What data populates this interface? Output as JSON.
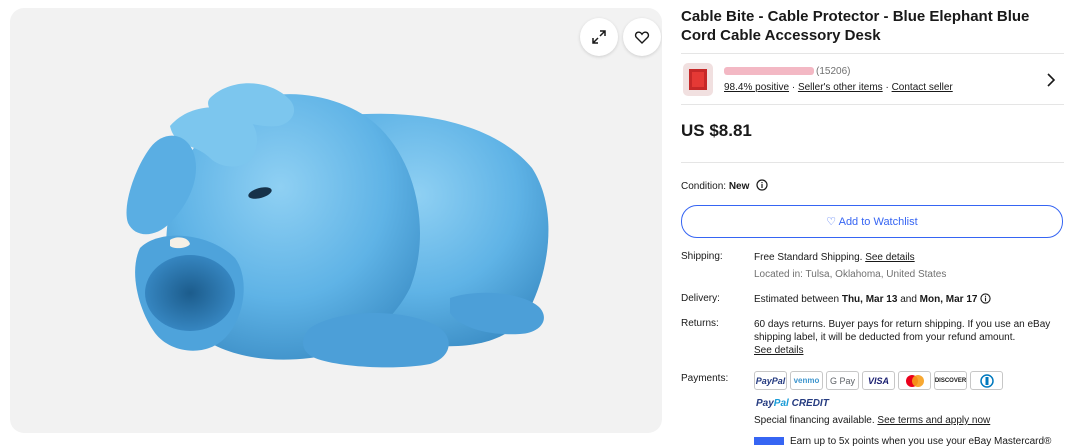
{
  "gallery": {
    "expand_icon": "expand-icon",
    "favorite_icon": "heart-icon"
  },
  "product": {
    "title": "Cable Bite - Cable Protector - Blue Elephant Blue Cord Cable Accessory Desk",
    "price": "US $8.81"
  },
  "seller": {
    "feedback_count": "(15206)",
    "positive": "98.4% positive",
    "other_items": "Seller's other items",
    "contact": "Contact seller",
    "separator": "·"
  },
  "condition": {
    "label": "Condition:",
    "value": "New"
  },
  "watchlist": {
    "label": "♡ Add to Watchlist"
  },
  "shipping": {
    "label": "Shipping:",
    "value": "Free Standard Shipping.",
    "link": "See details",
    "location": "Located in: Tulsa, Oklahoma, United States"
  },
  "delivery": {
    "label": "Delivery:",
    "prefix": "Estimated between",
    "start": "Thu, Mar 13",
    "and": "and",
    "end": "Mon, Mar 17"
  },
  "returns": {
    "label": "Returns:",
    "text": "60 days returns. Buyer pays for return shipping. If you use an eBay shipping label, it will be deducted from your refund amount.",
    "link": "See details"
  },
  "payments": {
    "label": "Payments:",
    "methods": [
      "PayPal",
      "venmo",
      "G Pay",
      "VISA",
      "Mastercard",
      "DISCOVER",
      "Diners Club"
    ],
    "paypal_credit_1": "Pay",
    "paypal_credit_2": "Pal",
    "paypal_credit_3": "CREDIT",
    "financing": "Special financing available.",
    "financing_link": "See terms and apply now",
    "mastercard_promo": "Earn up to 5x points when you use your eBay Mastercard®"
  },
  "colors": {
    "accent": "#3665f3",
    "elephant": "#5fb3e6",
    "text": "#191919"
  }
}
